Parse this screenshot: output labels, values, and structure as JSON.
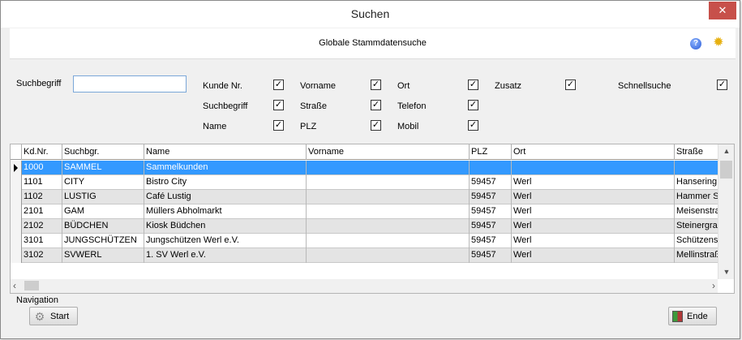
{
  "window": {
    "title": "Suchen",
    "close_symbol": "✕"
  },
  "header": {
    "title": "Globale Stammdatensuche",
    "help_icon": "help-icon",
    "settings_icon": "gear-icon",
    "help_glyph": "?",
    "settings_glyph": "✹"
  },
  "filters": {
    "search_label": "Suchbegriff",
    "search_value": "",
    "checkboxes": [
      {
        "label": "Kunde Nr.",
        "checked": "✓"
      },
      {
        "label": "Vorname",
        "checked": "✓"
      },
      {
        "label": "Ort",
        "checked": "✓"
      },
      {
        "label": "Zusatz",
        "checked": "✓"
      },
      {
        "label": "Schnellsuche",
        "checked": "✓"
      },
      {
        "label": "Suchbegriff",
        "checked": "✓"
      },
      {
        "label": "Straße",
        "checked": "✓"
      },
      {
        "label": "Telefon",
        "checked": "✓"
      },
      {
        "label": "Name",
        "checked": "✓"
      },
      {
        "label": "PLZ",
        "checked": "✓"
      },
      {
        "label": "Mobil",
        "checked": "✓"
      }
    ]
  },
  "grid": {
    "columns": [
      "Kd.Nr.",
      "Suchbgr.",
      "Name",
      "Vorname",
      "PLZ",
      "Ort",
      "Straße"
    ],
    "rows": [
      [
        "1000",
        "SAMMEL",
        "Sammelkunden",
        "",
        "",
        "",
        ""
      ],
      [
        "1101",
        "CITY",
        "Bistro City",
        "",
        "59457",
        "Werl",
        "Hansering"
      ],
      [
        "1102",
        "LUSTIG",
        "Café Lustig",
        "",
        "59457",
        "Werl",
        "Hammer St"
      ],
      [
        "2101",
        "GAM",
        "Müllers Abholmarkt",
        "",
        "59457",
        "Werl",
        "Meisenstra"
      ],
      [
        "2102",
        "BÜDCHEN",
        "Kiosk Büdchen",
        "",
        "59457",
        "Werl",
        "Steinergrab"
      ],
      [
        "3101",
        "JUNGSCHÜTZEN",
        "Jungschützen Werl e.V.",
        "",
        "59457",
        "Werl",
        "Schützens"
      ],
      [
        "3102",
        "SVWERL",
        "1. SV Werl e.V.",
        "",
        "59457",
        "Werl",
        "Mellinstraß"
      ]
    ],
    "selected_row": 0,
    "scroll": {
      "up": "▲",
      "down": "▼",
      "left": "‹",
      "right": "›"
    }
  },
  "footer": {
    "navigation_label": "Navigation",
    "start_label": "Start",
    "end_label": "Ende",
    "start_glyph": "⚙",
    "colors": {
      "selection": "#3399ff",
      "alt_row": "#e4e4e4",
      "close": "#c7504a"
    }
  }
}
